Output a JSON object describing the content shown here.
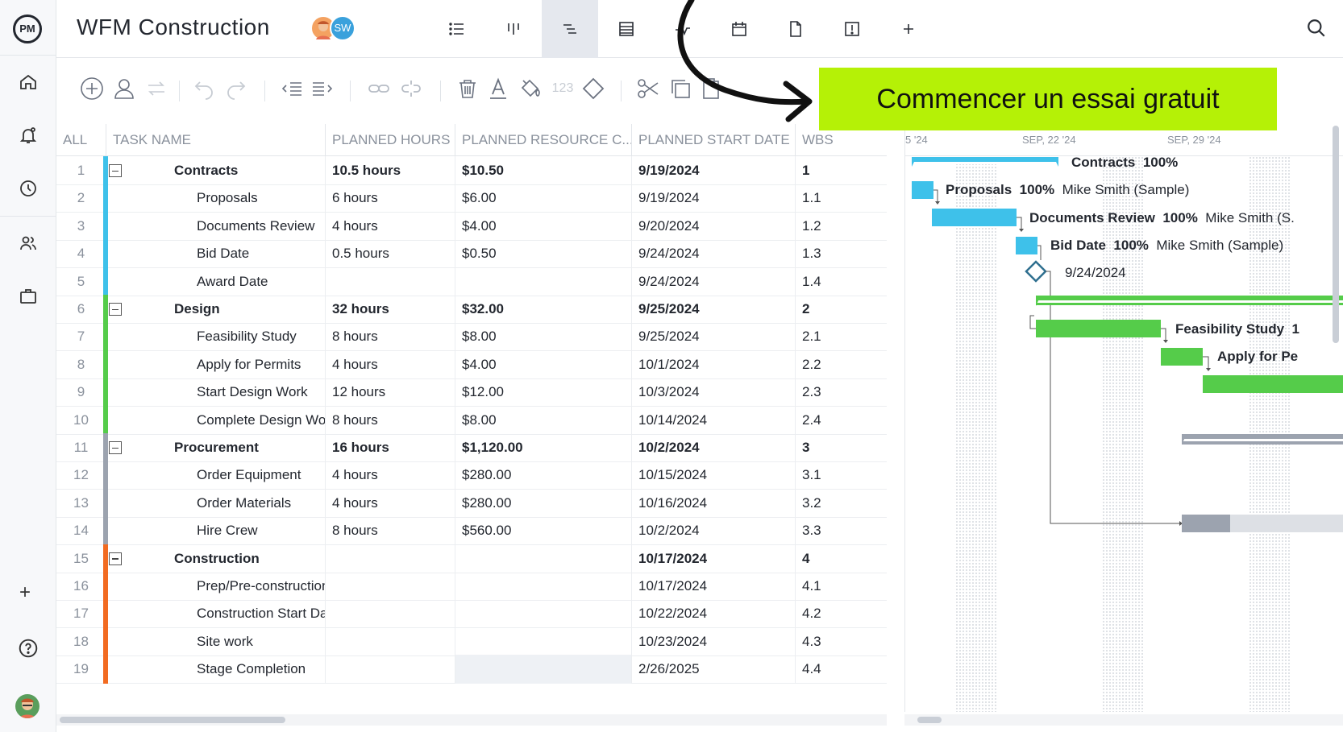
{
  "app": {
    "logo": "PM",
    "title": "WFM Construction",
    "avatar_initials": "SW"
  },
  "sidebar": {
    "items": [
      {
        "name": "home-icon"
      },
      {
        "name": "notifications-icon"
      },
      {
        "name": "clock-icon"
      },
      {
        "name": "people-icon"
      },
      {
        "name": "briefcase-icon"
      }
    ],
    "add": "+"
  },
  "views": [
    {
      "name": "list-view",
      "icon": "list-icon"
    },
    {
      "name": "board-view",
      "icon": "board-icon"
    },
    {
      "name": "gantt-view",
      "icon": "gantt-icon",
      "active": true
    },
    {
      "name": "sheet-view",
      "icon": "sheet-icon"
    },
    {
      "name": "dashboard-view",
      "icon": "pulse-icon"
    },
    {
      "name": "calendar-view",
      "icon": "calendar-icon"
    },
    {
      "name": "docs-view",
      "icon": "document-icon"
    },
    {
      "name": "risk-view",
      "icon": "alert-icon"
    },
    {
      "name": "add-view",
      "icon": "plus-icon"
    }
  ],
  "toolbar": {
    "number_label": "123"
  },
  "cta": {
    "label": "Commencer un essai gratuit",
    "color": "#b5f106"
  },
  "table": {
    "columns": [
      "ALL",
      "TASK NAME",
      "PLANNED HOURS",
      "PLANNED RESOURCE C...",
      "PLANNED START DATE",
      "WBS"
    ],
    "rows": [
      {
        "n": "1",
        "name": "Contracts",
        "hours": "10.5 hours",
        "cost": "$10.50",
        "start": "9/19/2024",
        "wbs": "1",
        "group": true,
        "color": "#3ec1ea"
      },
      {
        "n": "2",
        "name": "Proposals",
        "hours": "6 hours",
        "cost": "$6.00",
        "start": "9/19/2024",
        "wbs": "1.1",
        "color": "#3ec1ea"
      },
      {
        "n": "3",
        "name": "Documents Review",
        "hours": "4 hours",
        "cost": "$4.00",
        "start": "9/20/2024",
        "wbs": "1.2",
        "color": "#3ec1ea"
      },
      {
        "n": "4",
        "name": "Bid Date",
        "hours": "0.5 hours",
        "cost": "$0.50",
        "start": "9/24/2024",
        "wbs": "1.3",
        "color": "#3ec1ea"
      },
      {
        "n": "5",
        "name": "Award Date",
        "hours": "",
        "cost": "",
        "start": "9/24/2024",
        "wbs": "1.4",
        "color": "#3ec1ea"
      },
      {
        "n": "6",
        "name": "Design",
        "hours": "32 hours",
        "cost": "$32.00",
        "start": "9/25/2024",
        "wbs": "2",
        "group": true,
        "color": "#55cc4a"
      },
      {
        "n": "7",
        "name": "Feasibility Study",
        "hours": "8 hours",
        "cost": "$8.00",
        "start": "9/25/2024",
        "wbs": "2.1",
        "color": "#55cc4a"
      },
      {
        "n": "8",
        "name": "Apply for Permits",
        "hours": "4 hours",
        "cost": "$4.00",
        "start": "10/1/2024",
        "wbs": "2.2",
        "color": "#55cc4a"
      },
      {
        "n": "9",
        "name": "Start Design Work",
        "hours": "12 hours",
        "cost": "$12.00",
        "start": "10/3/2024",
        "wbs": "2.3",
        "color": "#55cc4a"
      },
      {
        "n": "10",
        "name": "Complete Design Work",
        "hours": "8 hours",
        "cost": "$8.00",
        "start": "10/14/2024",
        "wbs": "2.4",
        "color": "#55cc4a"
      },
      {
        "n": "11",
        "name": "Procurement",
        "hours": "16 hours",
        "cost": "$1,120.00",
        "start": "10/2/2024",
        "wbs": "3",
        "group": true,
        "color": "#9ca3af"
      },
      {
        "n": "12",
        "name": "Order Equipment",
        "hours": "4 hours",
        "cost": "$280.00",
        "start": "10/15/2024",
        "wbs": "3.1",
        "color": "#9ca3af"
      },
      {
        "n": "13",
        "name": "Order Materials",
        "hours": "4 hours",
        "cost": "$280.00",
        "start": "10/16/2024",
        "wbs": "3.2",
        "color": "#9ca3af"
      },
      {
        "n": "14",
        "name": "Hire Crew",
        "hours": "8 hours",
        "cost": "$560.00",
        "start": "10/2/2024",
        "wbs": "3.3",
        "color": "#9ca3af"
      },
      {
        "n": "15",
        "name": "Construction",
        "hours": "",
        "cost": "",
        "start": "10/17/2024",
        "wbs": "4",
        "group": true,
        "color": "#f26b21"
      },
      {
        "n": "16",
        "name": "Prep/Pre-construction",
        "hours": "",
        "cost": "",
        "start": "10/17/2024",
        "wbs": "4.1",
        "color": "#f26b21"
      },
      {
        "n": "17",
        "name": "Construction Start Date",
        "hours": "",
        "cost": "",
        "start": "10/22/2024",
        "wbs": "4.2",
        "color": "#f26b21"
      },
      {
        "n": "18",
        "name": "Site work",
        "hours": "",
        "cost": "",
        "start": "10/23/2024",
        "wbs": "4.3",
        "color": "#f26b21"
      },
      {
        "n": "19",
        "name": "Stage Completion",
        "hours": "",
        "cost": "",
        "start": "2/26/2025",
        "wbs": "4.4",
        "color": "#f26b21"
      }
    ]
  },
  "gantt": {
    "dates": [
      "5 '24",
      "SEP, 22 '24",
      "SEP, 29 '24"
    ],
    "labels": {
      "contracts_name": "Contracts",
      "contracts_pct": "100%",
      "proposals_name": "Proposals",
      "proposals_pct": "100%",
      "proposals_owner": "Mike Smith (Sample)",
      "docs_name": "Documents Review",
      "docs_pct": "100%",
      "docs_owner": "Mike Smith (S.",
      "bid_name": "Bid Date",
      "bid_pct": "100%",
      "bid_owner": "Mike Smith (Sample)",
      "award_date": "9/24/2024",
      "feas_name": "Feasibility Study",
      "feas_pct": "1",
      "permits_name": "Apply for Pe"
    },
    "colors": {
      "blue": "#3ec1ea",
      "green": "#55cc4a",
      "gray": "#9ca3af"
    }
  }
}
